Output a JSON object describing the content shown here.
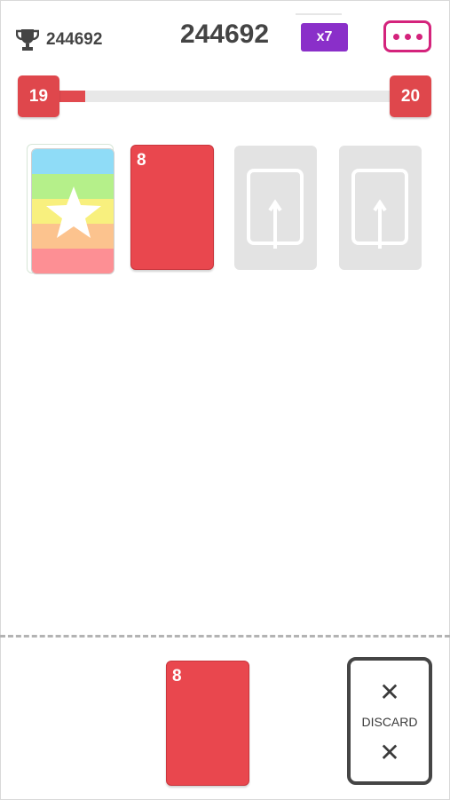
{
  "header": {
    "best_score": "244692",
    "score": "244692",
    "multiplier": "x7",
    "menu_icon": "more-dots-icon",
    "trophy_icon": "trophy-icon",
    "menu_color": "#d4237c",
    "multiplier_color": "#8a2fc9"
  },
  "level": {
    "current": "19",
    "next": "20",
    "progress": 0.14,
    "color": "#df474c"
  },
  "board": {
    "wild_card": {
      "icon": "star-icon",
      "colors": [
        "#8fdcf7",
        "#b5f08a",
        "#f8f07e",
        "#fcc38e",
        "#fd8f94",
        "#fc5e9a"
      ]
    },
    "played_card": {
      "value": "8",
      "color": "#e9474e"
    },
    "empty_slots": [
      {
        "icon": "card-upload-icon"
      },
      {
        "icon": "card-upload-icon"
      }
    ]
  },
  "hand": {
    "current_card": {
      "value": "8",
      "color": "#e9474e"
    },
    "discard_label": "DISCARD",
    "discard_icon": "close-icon"
  }
}
